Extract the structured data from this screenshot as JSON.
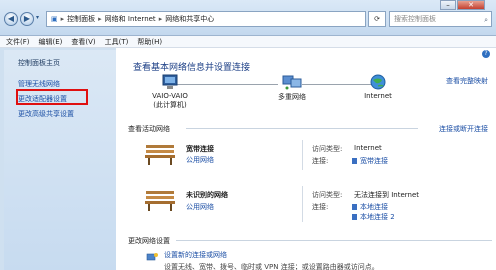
{
  "address": {
    "crumbs": [
      "控制面板",
      "网络和 Internet",
      "网络和共享中心"
    ],
    "search_placeholder": "搜索控制面板"
  },
  "menu": [
    "文件(F)",
    "编辑(E)",
    "查看(V)",
    "工具(T)",
    "帮助(H)"
  ],
  "sidebar": {
    "home": "控制面板主页",
    "items": [
      "管理无线网络",
      "更改适配器设置",
      "更改高级共享设置"
    ]
  },
  "main": {
    "heading": "查看基本网络信息并设置连接",
    "full_map_link": "查看完整映射",
    "nodes": [
      {
        "name": "VAIO-VAIO",
        "sub": "(此计算机)"
      },
      {
        "name": "多重网络",
        "sub": ""
      },
      {
        "name": "Internet",
        "sub": ""
      }
    ],
    "active_title": "查看活动网络",
    "connect_link": "连接或断开连接",
    "networks": [
      {
        "name": "宽带连接",
        "type": "公用网络",
        "access_label": "访问类型:",
        "access_value": "Internet",
        "conn_label": "连接:",
        "conn_values": [
          "宽带连接"
        ]
      },
      {
        "name": "未识别的网络",
        "type": "公用网络",
        "access_label": "访问类型:",
        "access_value": "无法连接到 Internet",
        "conn_label": "连接:",
        "conn_values": [
          "本地连接",
          "本地连接 2"
        ]
      }
    ],
    "change_title": "更改网络设置",
    "setup_link": "设置新的连接或网络",
    "setup_desc": "设置无线、宽带、拨号、临时或 VPN 连接；或设置路由器或访问点。"
  }
}
